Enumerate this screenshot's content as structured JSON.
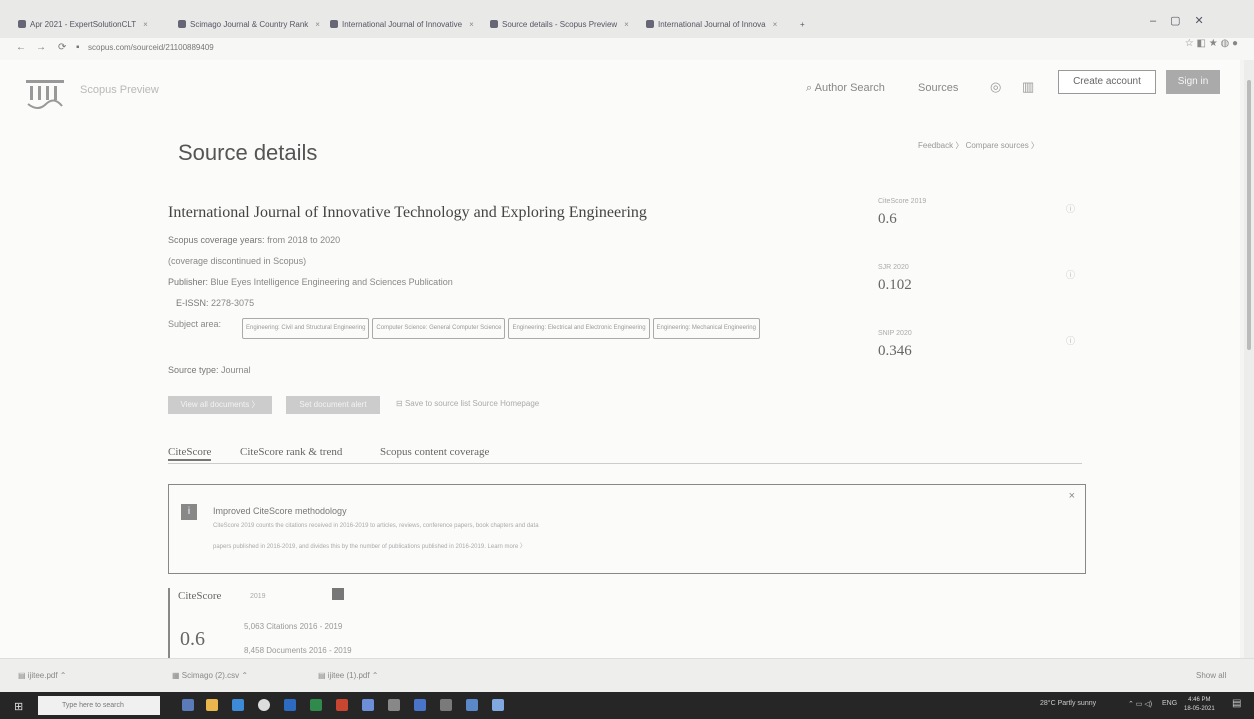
{
  "browser": {
    "tabs": [
      {
        "label": "Apr 2021 - ExpertSolutionCLT"
      },
      {
        "label": "Scimago Journal & Country Rank"
      },
      {
        "label": "International Journal of Innovative"
      },
      {
        "label": "Source details - Scopus Preview"
      },
      {
        "label": "International Journal of Innova"
      }
    ],
    "url": "scopus.com/sourceid/21100889409"
  },
  "header": {
    "brand": "Scopus Preview",
    "author_search": "Author Search",
    "sources": "Sources",
    "create_account": "Create account",
    "sign_in": "Sign in"
  },
  "page": {
    "title": "Source details",
    "feedback": "Feedback  〉  Compare sources  〉"
  },
  "source": {
    "journal_title": "International Journal of Innovative Technology and Exploring Engineering",
    "coverage_label": "Scopus coverage years:",
    "coverage_value": "from 2018 to 2020",
    "discontinued": "(coverage discontinued in Scopus)",
    "publisher_label": "Publisher:",
    "publisher_value": "Blue Eyes Intelligence Engineering and Sciences Publication",
    "issn_label": "E-ISSN:",
    "issn_value": "2278-3075",
    "subject_label": "Subject area:",
    "subject_chips": [
      "Engineering: Civil and Structural Engineering",
      "Computer Science: General Computer Science",
      "Engineering: Electrical and Electronic Engineering",
      "Engineering: Mechanical Engineering"
    ],
    "type_label": "Source type:",
    "type_value": "Journal",
    "view_all_documents": "View all documents 〉",
    "set_alert": "Set document alert",
    "save_to_list": "Save to source list   Source Homepage"
  },
  "metrics": [
    {
      "label": "CiteScore 2019",
      "value": "0.6"
    },
    {
      "label": "SJR 2020",
      "value": "0.102"
    },
    {
      "label": "SNIP 2020",
      "value": "0.346"
    }
  ],
  "tabs": [
    {
      "label": "CiteScore"
    },
    {
      "label": "CiteScore rank & trend"
    },
    {
      "label": "Scopus content coverage"
    }
  ],
  "notice": {
    "icon": "i",
    "title": "Improved CiteScore methodology",
    "line1": "CiteScore 2019 counts the citations received in 2016-2019 to articles, reviews, conference papers, book chapters and data",
    "line2": "papers published in 2016-2019, and divides this by the number of publications published in 2016-2019.  Learn more 〉",
    "close": "×"
  },
  "citescore": {
    "title": "CiteScore",
    "year": "2019",
    "value": "0.6",
    "citations": "5,063 Citations 2016 - 2019",
    "documents": "8,458 Documents 2016 - 2019"
  },
  "downloads": [
    {
      "label": "ijitee.pdf"
    },
    {
      "label": "Scimago (2).csv"
    },
    {
      "label": "ijitee (1).pdf"
    },
    {
      "label": "Show all"
    }
  ],
  "taskbar": {
    "search_placeholder": "Type here to search",
    "weather": "28°C  Partly sunny",
    "lang": "ENG",
    "time": "4:46 PM",
    "date": "18-05-2021"
  }
}
